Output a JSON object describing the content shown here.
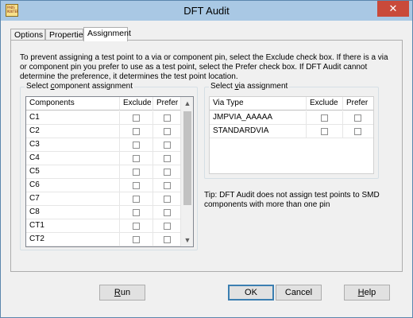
{
  "window": {
    "title": "DFT Audit",
    "app_icon_text": "PADS ROUTER",
    "close_glyph": "✕"
  },
  "tabs": [
    {
      "label": "Options",
      "active": false
    },
    {
      "label": "Properties",
      "active": false
    },
    {
      "label": "Assignment",
      "active": true
    }
  ],
  "intro_text": "To prevent assigning a test point to a via or component pin, select the Exclude check box. If there is a via\nor component pin you prefer to use as a test point, select the Prefer check box. If DFT Audit cannot\ndetermine the preference, it determines the test point location.",
  "component_group": {
    "label_prefix": "Select ",
    "label_accel": "c",
    "label_suffix": "omponent assignment",
    "columns": [
      "Components",
      "Exclude",
      "Prefer"
    ],
    "rows": [
      {
        "name": "C1",
        "exclude": false,
        "prefer": false
      },
      {
        "name": "C2",
        "exclude": false,
        "prefer": false
      },
      {
        "name": "C3",
        "exclude": false,
        "prefer": false
      },
      {
        "name": "C4",
        "exclude": false,
        "prefer": false
      },
      {
        "name": "C5",
        "exclude": false,
        "prefer": false
      },
      {
        "name": "C6",
        "exclude": false,
        "prefer": false
      },
      {
        "name": "C7",
        "exclude": false,
        "prefer": false
      },
      {
        "name": "C8",
        "exclude": false,
        "prefer": false
      },
      {
        "name": "CT1",
        "exclude": false,
        "prefer": false
      },
      {
        "name": "CT2",
        "exclude": false,
        "prefer": false
      }
    ],
    "scroll_up_icon": "chevron-up-icon",
    "scroll_down_icon": "chevron-down-icon"
  },
  "via_group": {
    "label_prefix": "Select ",
    "label_accel": "v",
    "label_suffix": "ia assignment",
    "columns": [
      "Via Type",
      "Exclude",
      "Prefer"
    ],
    "rows": [
      {
        "name": "JMPVIA_AAAAA",
        "exclude": false,
        "prefer": false
      },
      {
        "name": "STANDARDVIA",
        "exclude": false,
        "prefer": false
      }
    ]
  },
  "tip": {
    "label": "Tip:",
    "text": "DFT Audit does not assign test points to SMD components with more than one pin"
  },
  "buttons": {
    "run": {
      "accel": "R",
      "rest": "un"
    },
    "ok": {
      "label": "OK"
    },
    "cancel": {
      "label": "Cancel"
    },
    "help": {
      "accel": "H",
      "rest": "elp"
    }
  }
}
